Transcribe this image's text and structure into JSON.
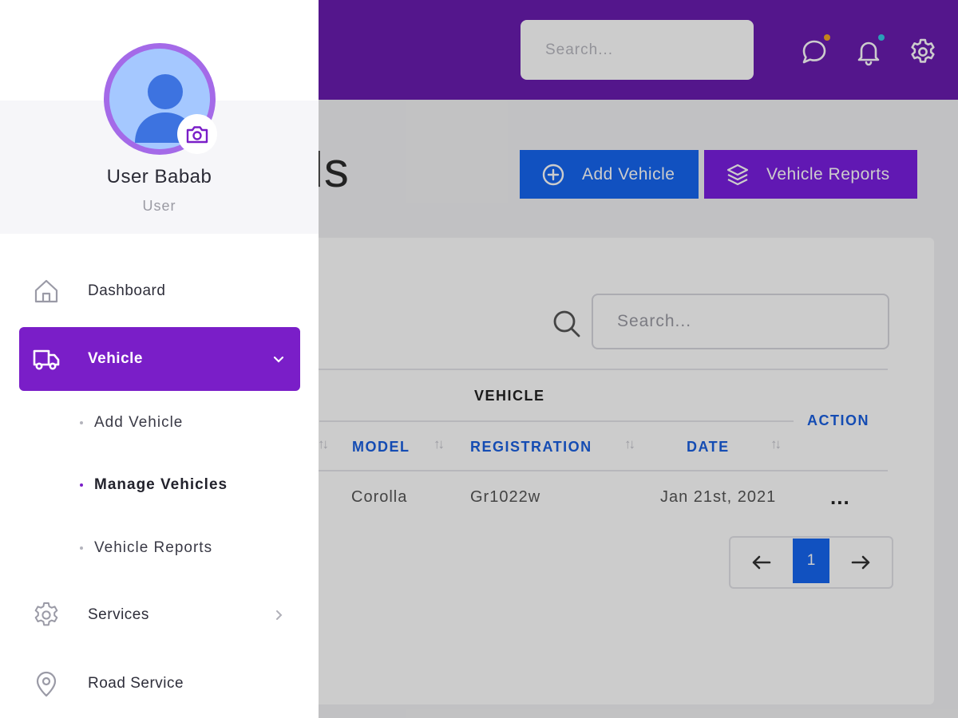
{
  "topbar": {
    "search_placeholder": "Search...",
    "icons": [
      "chat-icon",
      "bell-icon",
      "gear-icon"
    ],
    "chat_dot_color": "#f5a623",
    "bell_dot_color": "#35c6e6"
  },
  "page": {
    "title": "Records",
    "add_vehicle_label": "Add Vehicle",
    "vehicle_reports_label": "Vehicle Reports"
  },
  "table": {
    "search_placeholder": "Search...",
    "group_header": "VEHICLE",
    "columns": [
      "MODEL",
      "REGISTRATION",
      "DATE"
    ],
    "action_header": "ACTION",
    "rows": [
      {
        "model": "Corolla",
        "registration": "Gr1022w",
        "date": "Jan 21st, 2021",
        "action": "..."
      }
    ],
    "pagination": {
      "current_page": "1"
    }
  },
  "profile": {
    "name": "User Babab",
    "role": "User"
  },
  "sidebar": {
    "items": [
      {
        "label": "Dashboard",
        "icon": "home-icon"
      },
      {
        "label": "Vehicle",
        "icon": "truck-icon",
        "active": true
      },
      {
        "label": "Services",
        "icon": "gear-icon"
      },
      {
        "label": "Road Service",
        "icon": "map-pin-icon"
      }
    ],
    "vehicle_submenu": [
      {
        "label": "Add Vehicle"
      },
      {
        "label": "Manage Vehicles",
        "active": true
      },
      {
        "label": "Vehicle Reports"
      }
    ]
  },
  "colors": {
    "brand_purple": "#7a1ec8",
    "primary_blue": "#1666f0"
  }
}
